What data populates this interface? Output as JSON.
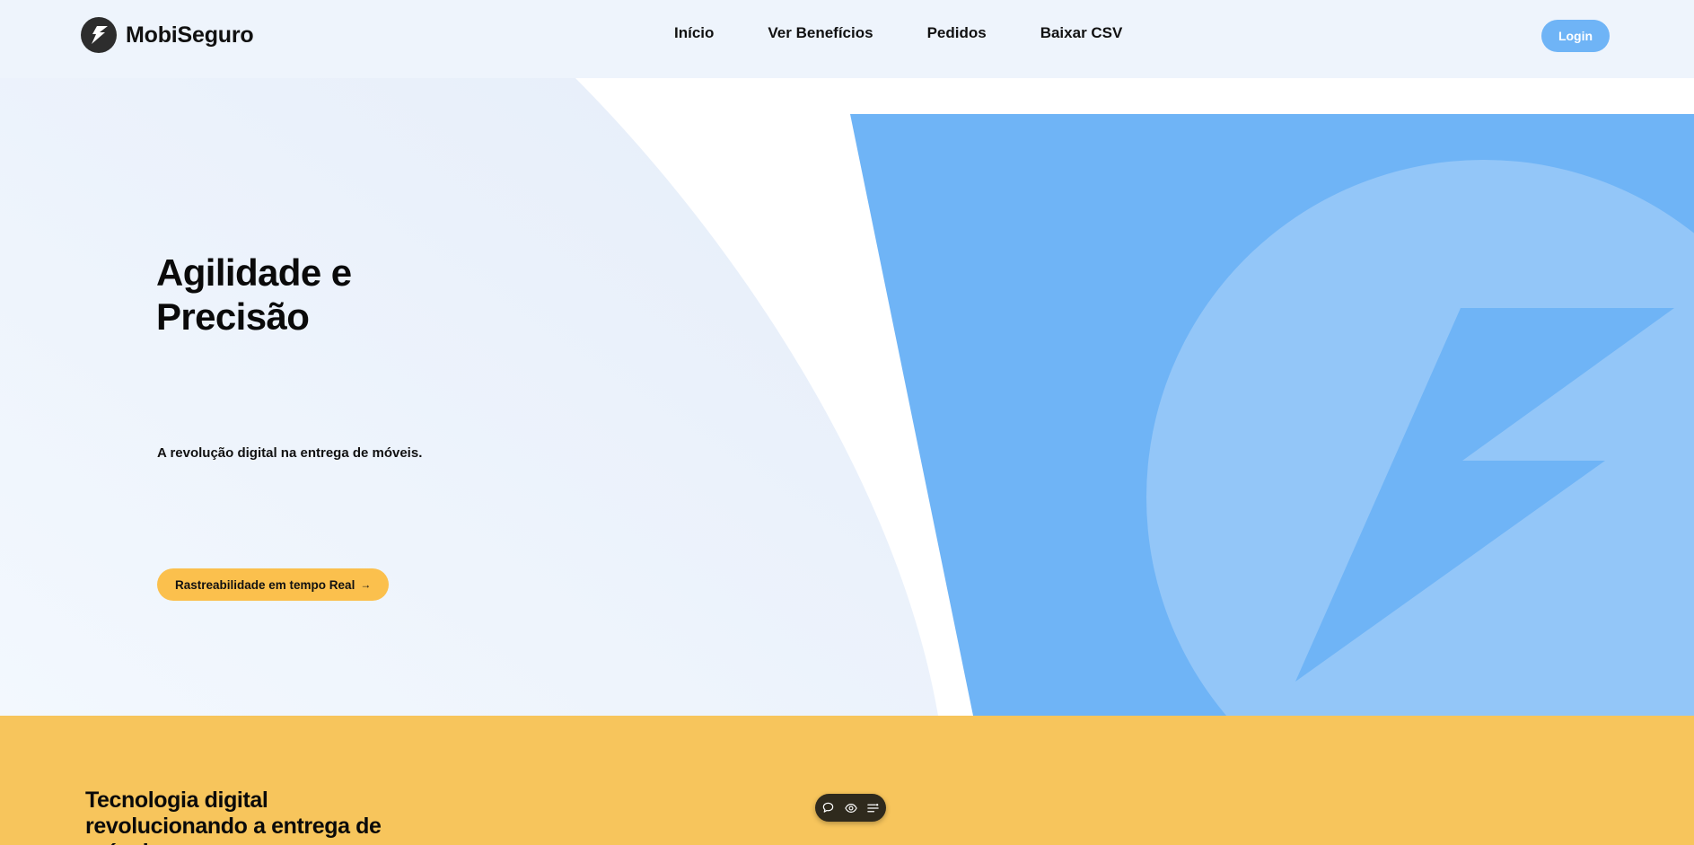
{
  "brand": {
    "name": "MobiSeguro",
    "logo_icon": "lightning-bolt-icon"
  },
  "nav": {
    "links": [
      {
        "label": "Início"
      },
      {
        "label": "Ver Benefícios"
      },
      {
        "label": "Pedidos"
      },
      {
        "label": "Baixar CSV"
      }
    ],
    "login_label": "Login"
  },
  "hero": {
    "title_line1": "Agilidade e",
    "title_line2": "Precisão",
    "subtitle": "A revolução digital na entrega de móveis.",
    "cta_label": "Rastreabilidade em tempo Real",
    "cta_icon": "arrow-right-icon"
  },
  "section2": {
    "title": "Tecnologia digital revolucionando a entrega de móveis"
  },
  "toolbar": {
    "icons": [
      "chat-bubble-icon",
      "eye-icon",
      "settings-list-icon"
    ]
  },
  "colors": {
    "nav_bg": "#eef4fc",
    "login_bg": "#6fb4f6",
    "cta_bg": "#fbc04d",
    "hero_blue": "#6fb4f6",
    "hero_light_blue": "#93c6f8",
    "section_yellow": "#f7c55c"
  }
}
